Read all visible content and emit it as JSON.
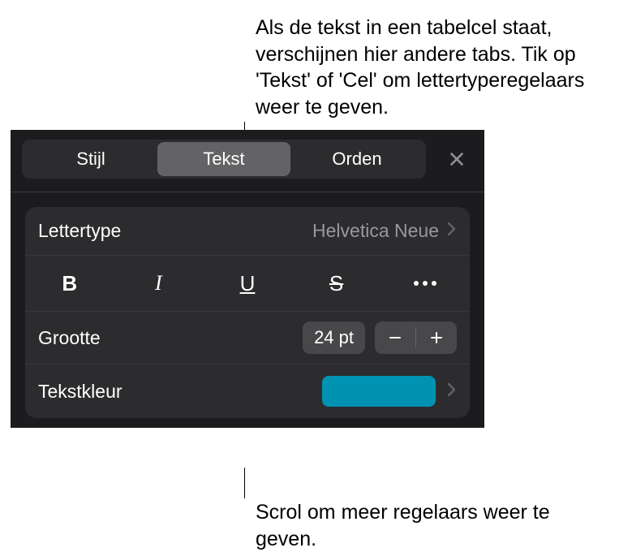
{
  "callouts": {
    "top": "Als de tekst in een tabelcel staat, verschijnen hier andere tabs. Tik op 'Tekst' of 'Cel' om lettertyperegelaars weer te geven.",
    "bottom": "Scrol om meer regelaars weer te geven."
  },
  "tabs": {
    "style": "Stijl",
    "text": "Tekst",
    "arrange": "Orden"
  },
  "font": {
    "label": "Lettertype",
    "value": "Helvetica Neue"
  },
  "style_buttons": {
    "bold": "B",
    "italic": "I",
    "underline": "U",
    "strike": "S"
  },
  "size": {
    "label": "Grootte",
    "value": "24 pt"
  },
  "text_color": {
    "label": "Tekstkleur",
    "swatch": "#0092b3"
  }
}
